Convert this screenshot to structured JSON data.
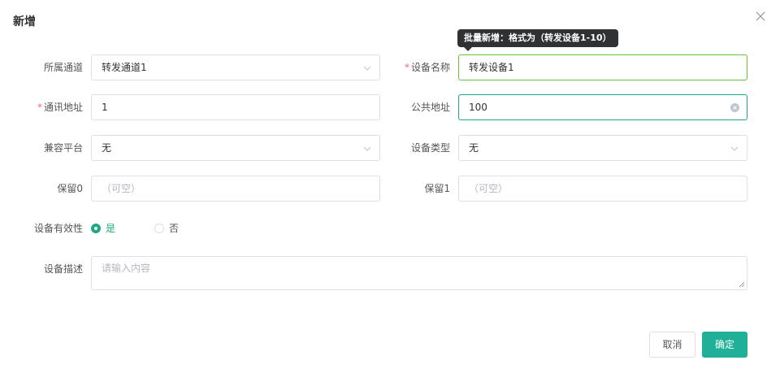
{
  "dialog": {
    "title": "新增"
  },
  "tooltip": {
    "text": "批量新增：格式为（转发设备1-10）"
  },
  "form": {
    "channel": {
      "label": "所属通道",
      "value": "转发通道1"
    },
    "device_name": {
      "label": "设备名称",
      "value": "转发设备1",
      "required": "*"
    },
    "comm_address": {
      "label": "通讯地址",
      "value": "1",
      "required": "*"
    },
    "public_address": {
      "label": "公共地址",
      "value": "100"
    },
    "compat_platform": {
      "label": "兼容平台",
      "value": "无"
    },
    "device_type": {
      "label": "设备类型",
      "value": "无"
    },
    "reserve0": {
      "label": "保留0",
      "placeholder": "（可空）"
    },
    "reserve1": {
      "label": "保留1",
      "placeholder": "（可空）"
    },
    "validity": {
      "label": "设备有效性",
      "options": [
        "是",
        "否"
      ],
      "selected": "是"
    },
    "description": {
      "label": "设备描述",
      "placeholder": "请输入内容"
    }
  },
  "footer": {
    "cancel_label": "取消",
    "ok_label": "确定"
  },
  "colors": {
    "primary": "#20b097",
    "focus_border": "#20a884",
    "active_border": "#67c23a",
    "required": "#f56c6c",
    "tooltip_bg": "#303133"
  },
  "icons": {
    "close": "close-icon",
    "dropdown": "chevron-down-icon",
    "clear": "clear-circle-icon"
  }
}
